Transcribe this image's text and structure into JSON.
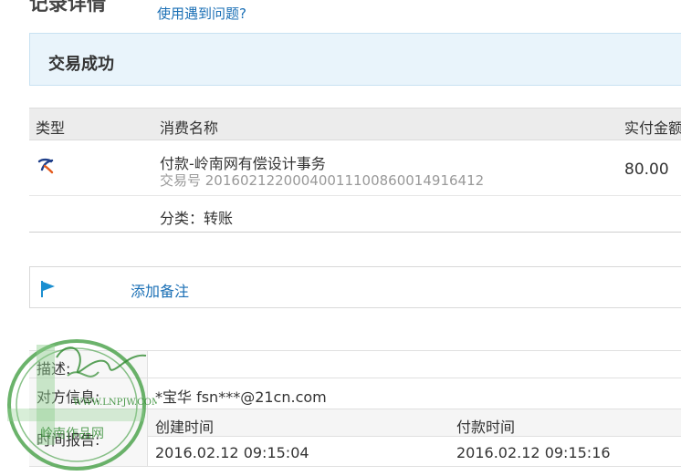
{
  "header": {
    "title": "记录详情",
    "help_link": "使用遇到问题?"
  },
  "status": {
    "text": "交易成功"
  },
  "table": {
    "columns": [
      "类型",
      "消费名称",
      "实付金额"
    ],
    "row": {
      "type_icon": "alipay-transfer-icon",
      "name": "付款-岭南网有偿设计事务",
      "trade_no": "交易号 2016021220004001110086001491​6412",
      "amount": "80.00",
      "category": "分类：转账"
    }
  },
  "remark": {
    "icon": "flag-icon",
    "link": "添加备注"
  },
  "info": {
    "description_label": "描述:",
    "counterparty_label": "对方信息:",
    "counterparty_value": "*宝华 fsn***@21cn.com",
    "time_label": "时间报告:",
    "created_label": "创建时间",
    "paid_label": "付款时间",
    "created_value": "2016.02.12 09:15:04",
    "paid_value": "2016.02.12 09:15:16"
  },
  "watermark": {
    "url_text": "WWW.LNPJW.COM",
    "name_text": "岭南作品网"
  }
}
